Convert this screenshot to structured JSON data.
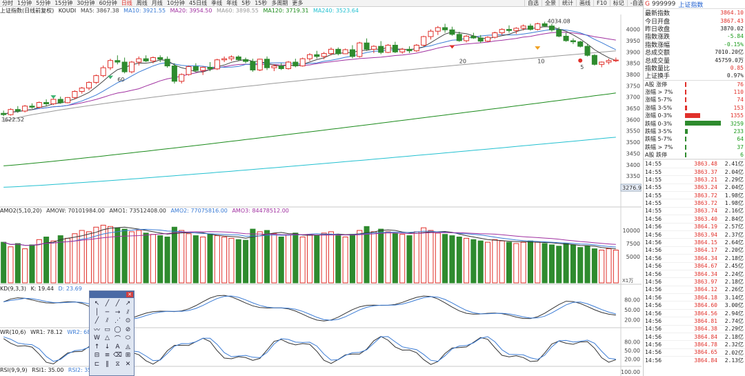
{
  "toolbar": {
    "timeframes": [
      "分时",
      "1分钟",
      "5分钟",
      "15分钟",
      "30分钟",
      "60分钟",
      "日线",
      "周线",
      "月线",
      "10分钟",
      "45日线",
      "季线",
      "年线",
      "5秒",
      "15秒",
      "多周期",
      "更多"
    ],
    "active_timeframe": "日线",
    "tools": [
      "自选",
      "全景",
      "统计",
      "画线",
      "F10",
      "标记",
      "-自选",
      "+自选"
    ]
  },
  "info_line": {
    "title": "上证指数(日线前复权)",
    "indicator": "KOUDI",
    "ma5": "MA5: 3867.38",
    "ma10": "MA10: 3921.55",
    "ma20": "MA20: 3954.50",
    "ma60": "MA60: 3898.55",
    "ma120": "MA120: 3719.31",
    "ma240": "MA240: 3523.64"
  },
  "colors": {
    "up": "#e0302a",
    "down": "#2e8b2e",
    "ma5": "#444444",
    "ma10": "#3a7bd5",
    "ma20": "#a030a0",
    "ma60": "#999999",
    "ma120": "#1a8a1a",
    "ma240": "#22c0d0"
  },
  "price_panel": {
    "axis_labels": [
      "4000",
      "3950",
      "3900",
      "3850",
      "3800",
      "3750",
      "3700",
      "3650",
      "3600",
      "3550",
      "3500",
      "3450",
      "3400",
      "3350"
    ],
    "high_label": "4034.08",
    "low_label": "3622.52",
    "current_label": "3276.9",
    "annotations": [
      "60",
      "20",
      "10",
      "5"
    ]
  },
  "amo_panel": {
    "header": {
      "name": "AMO2(5,10,20)",
      "amow": "AMOW: 70101984.00",
      "amo1": "AMO1: 73512408.00",
      "amo2": "AMO2: 77075816.00",
      "amo3": "AMO3: 84478512.00"
    },
    "axis_labels": [
      "10000",
      "7500",
      "5000"
    ],
    "unit": "X1万"
  },
  "kd_panel": {
    "header": {
      "name": "KD(9,3,3)",
      "k": "K: 19.44",
      "d": "D: 23.69"
    },
    "axis_labels": [
      "80.00",
      "50.00",
      "20.00"
    ]
  },
  "wr_panel": {
    "header": {
      "name": "WR(10,6)",
      "wr1": "WR1: 78.12",
      "wr2": "WR2: 68.56"
    },
    "axis_labels": [
      "80.00",
      "50.00",
      "20.00"
    ]
  },
  "rsi_panel": {
    "header": {
      "name": "RSI(9,9,9)",
      "rsi1": "RSI1: 35.00",
      "rsi2": "RSI2: 35.00"
    },
    "axis_labels": [
      "100.00"
    ]
  },
  "right_panel": {
    "title_g": "G",
    "code": "999999",
    "name": "上证指数",
    "stats": [
      {
        "label": "最新指数",
        "value": "3864.10",
        "cls": "up"
      },
      {
        "label": "今日开盘",
        "value": "3867.43",
        "cls": "up"
      },
      {
        "label": "昨日收盘",
        "value": "3870.02",
        "cls": "neutral"
      },
      {
        "label": "指数涨跌",
        "value": "-5.84",
        "cls": "down"
      },
      {
        "label": "指数涨幅",
        "value": "-0.15%",
        "cls": "down"
      },
      {
        "label": "总成交额",
        "value": "7010.20亿",
        "cls": "neutral"
      },
      {
        "label": "总成交量",
        "value": "45759.0万",
        "cls": "neutral"
      },
      {
        "label": "指数量比",
        "value": "0.85",
        "cls": "up"
      },
      {
        "label": "上证换手",
        "value": "0.97%",
        "cls": "neutral"
      }
    ],
    "distribution": [
      {
        "label": "A股 涨停",
        "value": "76",
        "pct": 0.02,
        "color": "#e0302a",
        "cls": "up"
      },
      {
        "label": "涨幅 > 7%",
        "value": "110",
        "pct": 0.03,
        "color": "#e0302a",
        "cls": "up"
      },
      {
        "label": "涨幅 5-7%",
        "value": "74",
        "pct": 0.02,
        "color": "#e0302a",
        "cls": "up"
      },
      {
        "label": "涨幅 3-5%",
        "value": "153",
        "pct": 0.05,
        "color": "#e0302a",
        "cls": "up"
      },
      {
        "label": "涨幅 0-3%",
        "value": "1355",
        "pct": 0.42,
        "color": "#e0302a",
        "cls": "up"
      },
      {
        "label": "跌幅 0-3%",
        "value": "3259",
        "pct": 1.0,
        "color": "#2e8b2e",
        "cls": "down"
      },
      {
        "label": "跌幅 3-5%",
        "value": "233",
        "pct": 0.07,
        "color": "#2e8b2e",
        "cls": "down"
      },
      {
        "label": "跌幅 5-7%",
        "value": "64",
        "pct": 0.02,
        "color": "#2e8b2e",
        "cls": "down"
      },
      {
        "label": "跌幅 > 7%",
        "value": "37",
        "pct": 0.01,
        "color": "#2e8b2e",
        "cls": "down"
      },
      {
        "label": "A股 跌停",
        "value": "6",
        "pct": 0.005,
        "color": "#2e8b2e",
        "cls": "down"
      }
    ],
    "ticks": [
      {
        "time": "14:55",
        "price": "3863.48",
        "vol": "2.41亿"
      },
      {
        "time": "14:55",
        "price": "3863.37",
        "vol": "2.04亿"
      },
      {
        "time": "14:55",
        "price": "3863.21",
        "vol": "2.29亿"
      },
      {
        "time": "14:55",
        "price": "3863.24",
        "vol": "2.04亿"
      },
      {
        "time": "14:55",
        "price": "3863.72",
        "vol": "1.98亿"
      },
      {
        "time": "14:55",
        "price": "3863.72",
        "vol": "1.98亿"
      },
      {
        "time": "14:55",
        "price": "3863.74",
        "vol": "2.16亿"
      },
      {
        "time": "14:56",
        "price": "3863.40",
        "vol": "2.84亿"
      },
      {
        "time": "14:56",
        "price": "3864.19",
        "vol": "2.57亿"
      },
      {
        "time": "14:56",
        "price": "3863.94",
        "vol": "2.37亿"
      },
      {
        "time": "14:56",
        "price": "3864.15",
        "vol": "2.64亿"
      },
      {
        "time": "14:56",
        "price": "3864.17",
        "vol": "2.20亿"
      },
      {
        "time": "14:56",
        "price": "3864.34",
        "vol": "2.18亿"
      },
      {
        "time": "14:56",
        "price": "3864.67",
        "vol": "2.45亿"
      },
      {
        "time": "14:56",
        "price": "3864.34",
        "vol": "2.24亿"
      },
      {
        "time": "14:56",
        "price": "3863.97",
        "vol": "2.18亿"
      },
      {
        "time": "14:56",
        "price": "3864.12",
        "vol": "2.26亿"
      },
      {
        "time": "14:56",
        "price": "3864.18",
        "vol": "3.14亿"
      },
      {
        "time": "14:56",
        "price": "3864.60",
        "vol": "3.00亿"
      },
      {
        "time": "14:56",
        "price": "3864.56",
        "vol": "2.94亿"
      },
      {
        "time": "14:56",
        "price": "3864.81",
        "vol": "2.74亿"
      },
      {
        "time": "14:56",
        "price": "3864.38",
        "vol": "2.29亿"
      },
      {
        "time": "14:56",
        "price": "3864.84",
        "vol": "2.18亿"
      },
      {
        "time": "14:56",
        "price": "3864.78",
        "vol": "2.32亿"
      },
      {
        "time": "14:56",
        "price": "3864.65",
        "vol": "2.02亿"
      },
      {
        "time": "14:56",
        "price": "3864.84",
        "vol": "2.13亿"
      }
    ]
  },
  "drawing_tools": {
    "icons": [
      "cursor-icon",
      "line-icon",
      "segment-icon",
      "ray-icon",
      "vline-icon",
      "hline-icon",
      "arrow-line-icon",
      "parallel-icon",
      "price-line-icon",
      "channel-icon",
      "fan-icon",
      "cycle-icon",
      "wave-icon",
      "rect-icon",
      "circle-icon",
      "gann-icon",
      "w-pattern-icon",
      "triangle-icon",
      "arc-icon",
      "ellipse-icon",
      "up-arrow-icon",
      "down-arrow-icon",
      "text-icon",
      "golden-icon",
      "fib-icon",
      "level-icon",
      "erase-icon",
      "grid-icon",
      "bracket-icon",
      "cycle-line-icon",
      "mirror-icon",
      "delete-icon"
    ],
    "glyphs": [
      "↖",
      "╱",
      "╱",
      "↗",
      "│",
      "─",
      "→",
      "⫽",
      "╱",
      "⫽",
      "⋰",
      "⊙",
      "〰",
      "▭",
      "◯",
      "⊘",
      "W",
      "△",
      "⌒",
      "⬭",
      "↑",
      "↓",
      "A",
      "◬",
      "⊟",
      "≡",
      "⌫",
      "⊞",
      "⊏",
      "‖",
      "⧖",
      "✕"
    ]
  },
  "chart_data": {
    "type": "candlestick",
    "ylim": [
      3276.9,
      4060
    ],
    "candles": [
      [
        3628,
        3640,
        3615,
        3622
      ],
      [
        3622,
        3650,
        3618,
        3645
      ],
      [
        3645,
        3660,
        3630,
        3638
      ],
      [
        3638,
        3665,
        3632,
        3660
      ],
      [
        3660,
        3672,
        3648,
        3655
      ],
      [
        3655,
        3680,
        3650,
        3676
      ],
      [
        3676,
        3690,
        3660,
        3670
      ],
      [
        3670,
        3695,
        3665,
        3690
      ],
      [
        3690,
        3702,
        3670,
        3675
      ],
      [
        3675,
        3700,
        3672,
        3698
      ],
      [
        3698,
        3730,
        3690,
        3725
      ],
      [
        3725,
        3745,
        3715,
        3740
      ],
      [
        3740,
        3770,
        3730,
        3765
      ],
      [
        3765,
        3800,
        3758,
        3795
      ],
      [
        3795,
        3840,
        3788,
        3830
      ],
      [
        3830,
        3870,
        3820,
        3862
      ],
      [
        3862,
        3885,
        3845,
        3855
      ],
      [
        3855,
        3875,
        3805,
        3812
      ],
      [
        3812,
        3860,
        3805,
        3855
      ],
      [
        3855,
        3880,
        3840,
        3870
      ],
      [
        3870,
        3885,
        3855,
        3860
      ],
      [
        3860,
        3880,
        3850,
        3875
      ],
      [
        3875,
        3885,
        3855,
        3868
      ],
      [
        3868,
        3880,
        3830,
        3838
      ],
      [
        3838,
        3850,
        3760,
        3770
      ],
      [
        3770,
        3805,
        3760,
        3800
      ],
      [
        3800,
        3840,
        3795,
        3835
      ],
      [
        3835,
        3850,
        3810,
        3818
      ],
      [
        3818,
        3835,
        3798,
        3832
      ],
      [
        3832,
        3855,
        3815,
        3825
      ],
      [
        3825,
        3870,
        3820,
        3865
      ],
      [
        3865,
        3880,
        3855,
        3870
      ],
      [
        3870,
        3885,
        3860,
        3878
      ],
      [
        3878,
        3885,
        3860,
        3866
      ],
      [
        3866,
        3875,
        3850,
        3858
      ],
      [
        3858,
        3870,
        3812,
        3820
      ],
      [
        3820,
        3870,
        3815,
        3868
      ],
      [
        3868,
        3880,
        3820,
        3830
      ],
      [
        3830,
        3845,
        3815,
        3838
      ],
      [
        3838,
        3850,
        3820,
        3826
      ],
      [
        3826,
        3860,
        3822,
        3855
      ],
      [
        3855,
        3870,
        3832,
        3838
      ],
      [
        3838,
        3875,
        3835,
        3870
      ],
      [
        3870,
        3895,
        3860,
        3888
      ],
      [
        3888,
        3905,
        3870,
        3880
      ],
      [
        3880,
        3900,
        3868,
        3893
      ],
      [
        3893,
        3920,
        3885,
        3912
      ],
      [
        3912,
        3920,
        3885,
        3892
      ],
      [
        3892,
        3915,
        3890,
        3910
      ],
      [
        3910,
        3930,
        3872,
        3880
      ],
      [
        3880,
        3945,
        3875,
        3940
      ],
      [
        3940,
        3960,
        3905,
        3912
      ],
      [
        3912,
        3930,
        3895,
        3925
      ],
      [
        3925,
        3948,
        3890,
        3898
      ],
      [
        3898,
        3935,
        3895,
        3930
      ],
      [
        3930,
        3945,
        3895,
        3900
      ],
      [
        3900,
        3918,
        3892,
        3912
      ],
      [
        3912,
        3925,
        3895,
        3905
      ],
      [
        3905,
        3935,
        3900,
        3930
      ],
      [
        3930,
        3972,
        3925,
        3968
      ],
      [
        3968,
        4000,
        3955,
        3992
      ],
      [
        3992,
        4015,
        3975,
        4008
      ],
      [
        4008,
        4025,
        3985,
        3998
      ],
      [
        3998,
        4012,
        3972,
        3978
      ],
      [
        3978,
        3990,
        3945,
        3950
      ],
      [
        3950,
        3975,
        3942,
        3970
      ],
      [
        3970,
        3985,
        3958,
        3962
      ],
      [
        3962,
        3975,
        3940,
        3948
      ],
      [
        3948,
        3970,
        3944,
        3965
      ],
      [
        3965,
        3990,
        3960,
        3985
      ],
      [
        3985,
        4005,
        3975,
        4000
      ],
      [
        4000,
        4018,
        3985,
        3995
      ],
      [
        3995,
        4010,
        3980,
        4005
      ],
      [
        4005,
        4022,
        3995,
        4015
      ],
      [
        4015,
        4025,
        3995,
        4000
      ],
      [
        4000,
        4030,
        3995,
        4025
      ],
      [
        4025,
        4034,
        4010,
        4015
      ],
      [
        4015,
        4025,
        3990,
        3998
      ],
      [
        3998,
        4010,
        3965,
        3970
      ],
      [
        3970,
        3985,
        3945,
        3950
      ],
      [
        3950,
        3960,
        3935,
        3945
      ],
      [
        3945,
        3950,
        3920,
        3925
      ],
      [
        3925,
        3935,
        3880,
        3885
      ],
      [
        3885,
        3890,
        3840,
        3845
      ],
      [
        3845,
        3858,
        3832,
        3855
      ],
      [
        3855,
        3870,
        3845,
        3862
      ],
      [
        3862,
        3875,
        3855,
        3864
      ]
    ],
    "volume": [
      62,
      55,
      60,
      52,
      58,
      66,
      70,
      64,
      72,
      68,
      75,
      80,
      78,
      85,
      88,
      86,
      84,
      82,
      78,
      80,
      76,
      74,
      72,
      70,
      85,
      80,
      75,
      72,
      70,
      74,
      72,
      70,
      68,
      66,
      65,
      82,
      78,
      80,
      75,
      70,
      73,
      76,
      70,
      74,
      72,
      76,
      78,
      72,
      70,
      74,
      80,
      86,
      78,
      82,
      78,
      76,
      74,
      72,
      78,
      84,
      80,
      76,
      74,
      72,
      70,
      68,
      66,
      64,
      62,
      66,
      64,
      62,
      60,
      62,
      64,
      62,
      60,
      58,
      56,
      60,
      58,
      54,
      56,
      52,
      50,
      52,
      50
    ]
  }
}
